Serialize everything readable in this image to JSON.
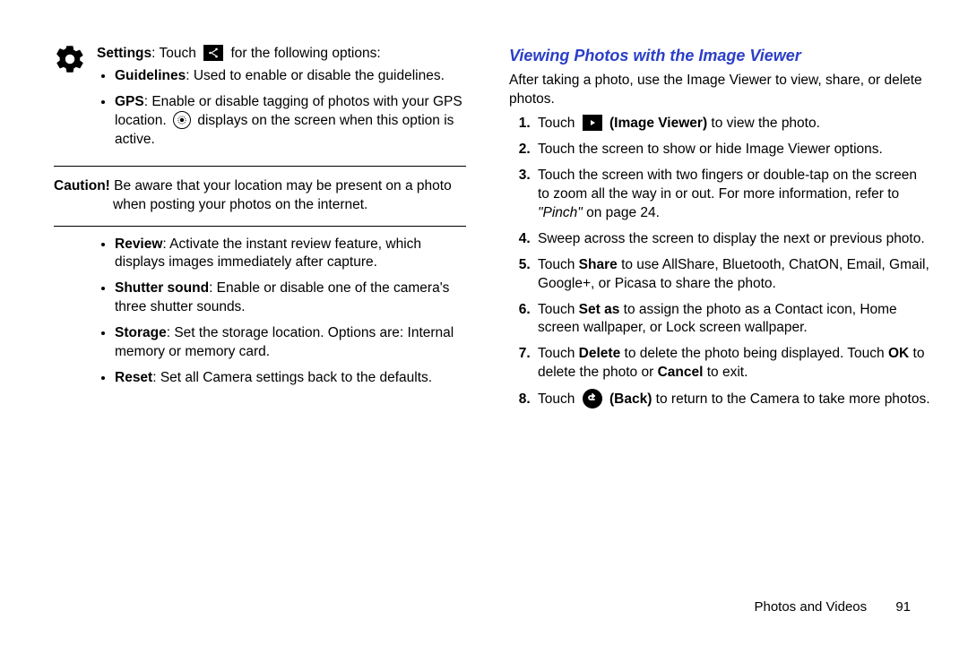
{
  "left": {
    "settings_label": "Settings",
    "settings_touch": ": Touch ",
    "settings_after": " for the following options:",
    "bullets1": [
      {
        "bold": "Guidelines",
        "text": ": Used to enable or disable the guidelines."
      }
    ],
    "gps_bold": "GPS",
    "gps_before": ": Enable or disable tagging of photos with your GPS location. ",
    "gps_after": " displays on the screen when this option is active.",
    "caution_label": "Caution! ",
    "caution_text": "Be aware that your location may be present on a photo when posting your photos on the internet.",
    "bullets2": [
      {
        "bold": "Review",
        "text": ": Activate the instant review feature, which displays images immediately after capture."
      },
      {
        "bold": "Shutter sound",
        "text": ": Enable or disable one of the camera's three shutter sounds."
      },
      {
        "bold": "Storage",
        "text": ": Set the storage location. Options are: Internal memory or memory card."
      },
      {
        "bold": "Reset",
        "text": ": Set all Camera settings back to the defaults."
      }
    ]
  },
  "right": {
    "heading": "Viewing Photos with the Image Viewer",
    "intro": "After taking a photo, use the Image Viewer to view, share, or delete photos.",
    "step1_a": "Touch ",
    "step1_b": " (Image Viewer)",
    "step1_c": " to view the photo.",
    "step2": "Touch the screen to show or hide Image Viewer options.",
    "step3_a": "Touch the screen with two fingers or double-tap on the screen to zoom all the way in or out. For more information, refer to ",
    "step3_pinch": "\"Pinch\"",
    "step3_b": "  on page 24.",
    "step4": "Sweep across the screen to display the next or previous photo.",
    "step5_a": "Touch ",
    "step5_bold": "Share",
    "step5_b": " to use AllShare, Bluetooth, ChatON, Email, Gmail, Google+, or Picasa to share the photo.",
    "step6_a": "Touch ",
    "step6_bold": "Set as",
    "step6_b": " to assign the photo as a Contact icon, Home screen wallpaper, or Lock screen wallpaper.",
    "step7_a": "Touch ",
    "step7_bold1": "Delete",
    "step7_b": " to delete the photo being displayed. Touch ",
    "step7_bold2": "OK",
    "step7_c": " to delete the photo or ",
    "step7_bold3": "Cancel",
    "step7_d": " to exit.",
    "step8_a": "Touch ",
    "step8_bold": " (Back)",
    "step8_b": " to return to the Camera to take more photos."
  },
  "footer": {
    "section": "Photos and Videos",
    "page": "91"
  }
}
